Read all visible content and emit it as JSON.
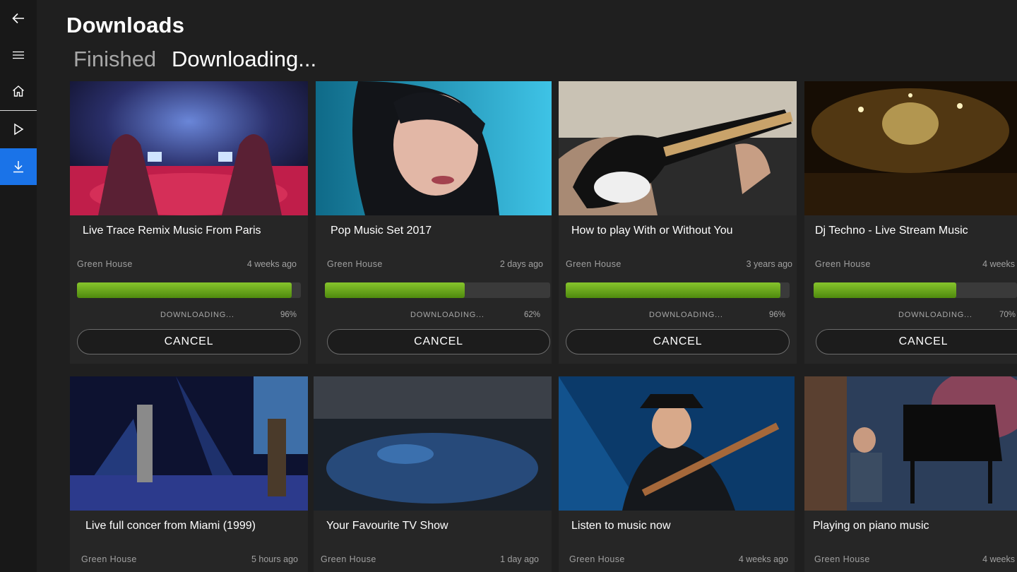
{
  "header": {
    "title": "Downloads"
  },
  "tabs": [
    {
      "label": "Finished",
      "active": false
    },
    {
      "label": "Downloading...",
      "active": true
    }
  ],
  "sidebar": {
    "items": [
      {
        "icon": "back-arrow-icon"
      },
      {
        "icon": "hamburger-menu-icon"
      },
      {
        "icon": "home-icon"
      },
      {
        "icon": "play-icon"
      },
      {
        "icon": "download-icon",
        "active": true
      }
    ]
  },
  "colors": {
    "accent": "#1a73e8",
    "progress": "#6aa71d",
    "background": "#1f1f1f",
    "card": "#262626"
  },
  "cards": [
    {
      "title": "Live Trace Remix Music From Paris",
      "channel": "Green House",
      "age": "4 weeks ago",
      "status": "DOWNLOADING...",
      "percent_label": "96%",
      "progress": 0.96,
      "cancel_label": "CANCEL"
    },
    {
      "title": "Pop Music Set 2017",
      "channel": "Green House",
      "age": "2 days ago",
      "status": "DOWNLOADING...",
      "percent_label": "62%",
      "progress": 0.62,
      "cancel_label": "CANCEL"
    },
    {
      "title": "How to play With or Without You",
      "channel": "Green House",
      "age": "3 years ago",
      "status": "DOWNLOADING...",
      "percent_label": "96%",
      "progress": 0.96,
      "cancel_label": "CANCEL"
    },
    {
      "title": "Dj Techno - Live Stream Music",
      "channel": "Green House",
      "age": "4 weeks",
      "status": "DOWNLOADING...",
      "percent_label": "70%",
      "progress": 0.7,
      "cancel_label": "CANCEL"
    },
    {
      "title": "Live full concer from Miami (1999)",
      "channel": "Green House",
      "age": "5 hours ago"
    },
    {
      "title": "Your Favourite TV Show",
      "channel": "Green House",
      "age": "1 day ago"
    },
    {
      "title": "Listen to music now",
      "channel": "Green House",
      "age": "4 weeks ago"
    },
    {
      "title": "Playing on piano music",
      "channel": "Green House",
      "age": "4 weeks"
    }
  ]
}
